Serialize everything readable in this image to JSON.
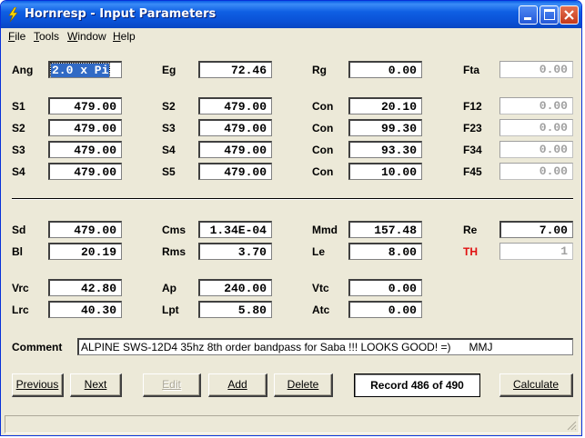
{
  "window": {
    "title": "Hornresp - Input Parameters",
    "icon": "lightning-bolt-icon"
  },
  "menu": [
    "File",
    "Tools",
    "Window",
    "Help"
  ],
  "labels": {
    "ang": "Ang",
    "eg": "Eg",
    "rg": "Rg",
    "fta": "Fta",
    "s1": "S1",
    "s2": "S2",
    "s3": "S3",
    "s4": "S4",
    "s5": "S5",
    "con": "Con",
    "f12": "F12",
    "f23": "F23",
    "f34": "F34",
    "f45": "F45",
    "sd": "Sd",
    "cms": "Cms",
    "mmd": "Mmd",
    "re": "Re",
    "bl": "Bl",
    "rms": "Rms",
    "le": "Le",
    "th": "TH",
    "vrc": "Vrc",
    "ap": "Ap",
    "vtc": "Vtc",
    "lrc": "Lrc",
    "lpt": "Lpt",
    "atc": "Atc",
    "comment": "Comment"
  },
  "values": {
    "ang": "2.0 x Pi",
    "eg": "72.46",
    "rg": "0.00",
    "fta": "0.00",
    "row1": {
      "s1": "479.00",
      "s2": "479.00",
      "con": "20.10",
      "f12": "0.00"
    },
    "row2": {
      "s2": "479.00",
      "s3": "479.00",
      "con": "99.30",
      "f23": "0.00"
    },
    "row3": {
      "s3": "479.00",
      "s4": "479.00",
      "con": "93.30",
      "f34": "0.00"
    },
    "row4": {
      "s4": "479.00",
      "s5": "479.00",
      "con": "10.00",
      "f45": "0.00"
    },
    "sd": "479.00",
    "cms": "1.34E-04",
    "mmd": "157.48",
    "re": "7.00",
    "bl": "20.19",
    "rms": "3.70",
    "le": "8.00",
    "th": "1",
    "vrc": "42.80",
    "ap": "240.00",
    "vtc": "0.00",
    "lrc": "40.30",
    "lpt": "5.80",
    "atc": "0.00",
    "comment": "ALPINE SWS-12D4 35hz 8th order bandpass for Saba !!! LOOKS GOOD! =)      MMJ"
  },
  "buttons": {
    "previous": "Previous",
    "next": "Next",
    "edit": "Edit",
    "add": "Add",
    "delete": "Delete",
    "calculate": "Calculate"
  },
  "record": "Record 486 of 490",
  "colors": {
    "title_bar": "#0a5ee6",
    "window_bg": "#ece9d8",
    "th_label": "#e01010",
    "selection": "#316ac5"
  }
}
